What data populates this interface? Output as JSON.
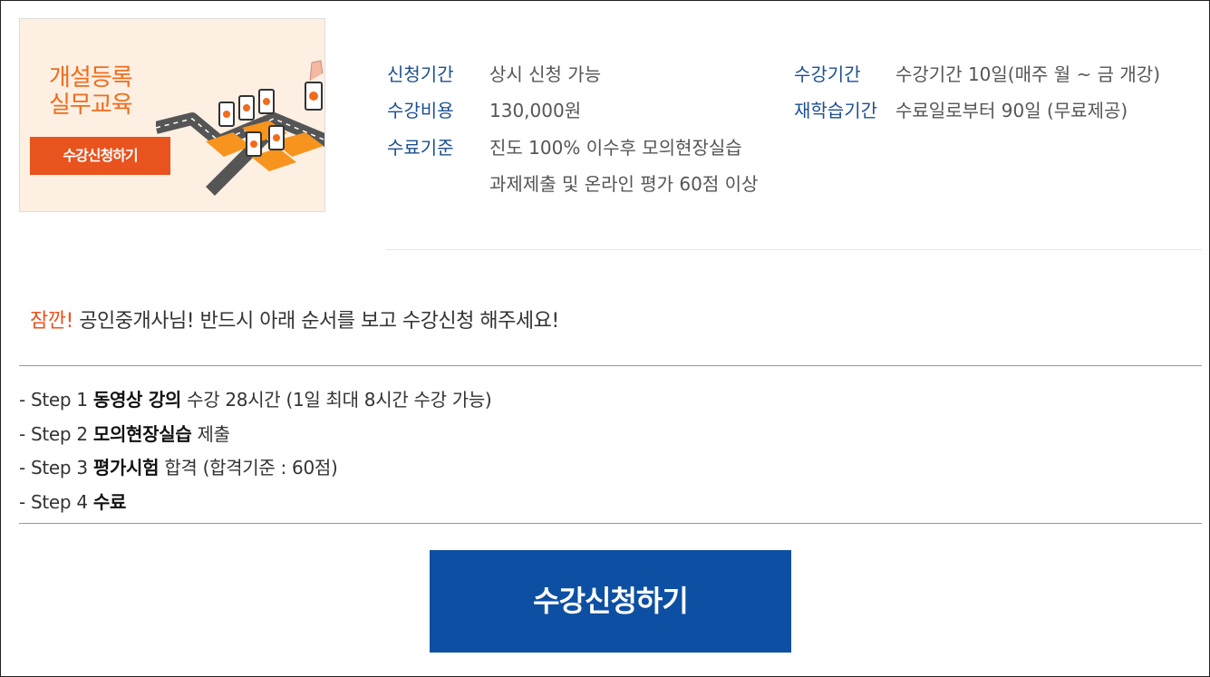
{
  "thumbnail": {
    "title_line1": "개설등록",
    "title_line2": "실무교육",
    "button_label": "수강신청하기",
    "colors": {
      "accent": "#f26b1d",
      "button": "#e8531e",
      "background": "#fdf0e2"
    }
  },
  "info": {
    "left": [
      {
        "label": "신청기간",
        "value": "상시 신청 가능"
      },
      {
        "label": "수강비용",
        "value": "130,000원"
      },
      {
        "label": "수료기준",
        "value": "진도 100% 이수후 모의현장실습",
        "value2": "과제제출 및 온라인 평가 60점 이상"
      }
    ],
    "right": [
      {
        "label": "수강기간",
        "value": "수강기간 10일(매주 월 ~ 금 개강)"
      },
      {
        "label": "재학습기간",
        "value": "수료일로부터 90일 (무료제공)"
      }
    ]
  },
  "notice": {
    "emphasis": "잠깐!",
    "text": " 공인중개사님! 반드시 아래 순서를 보고 수강신청 해주세요!"
  },
  "steps": [
    {
      "prefix": "- Step 1 ",
      "bold": "동영상 강의",
      "suffix": " 수강 28시간 (1일 최대 8시간 수강 가능)"
    },
    {
      "prefix": "- Step 2 ",
      "bold": "모의현장실습",
      "suffix": " 제출"
    },
    {
      "prefix": "- Step 3 ",
      "bold": "평가시험",
      "suffix": " 합격 (합격기준 : 60점)"
    },
    {
      "prefix": "- Step 4 ",
      "bold": "수료",
      "suffix": ""
    }
  ],
  "apply_button": {
    "label": "수강신청하기",
    "color": "#0d4fa3"
  }
}
